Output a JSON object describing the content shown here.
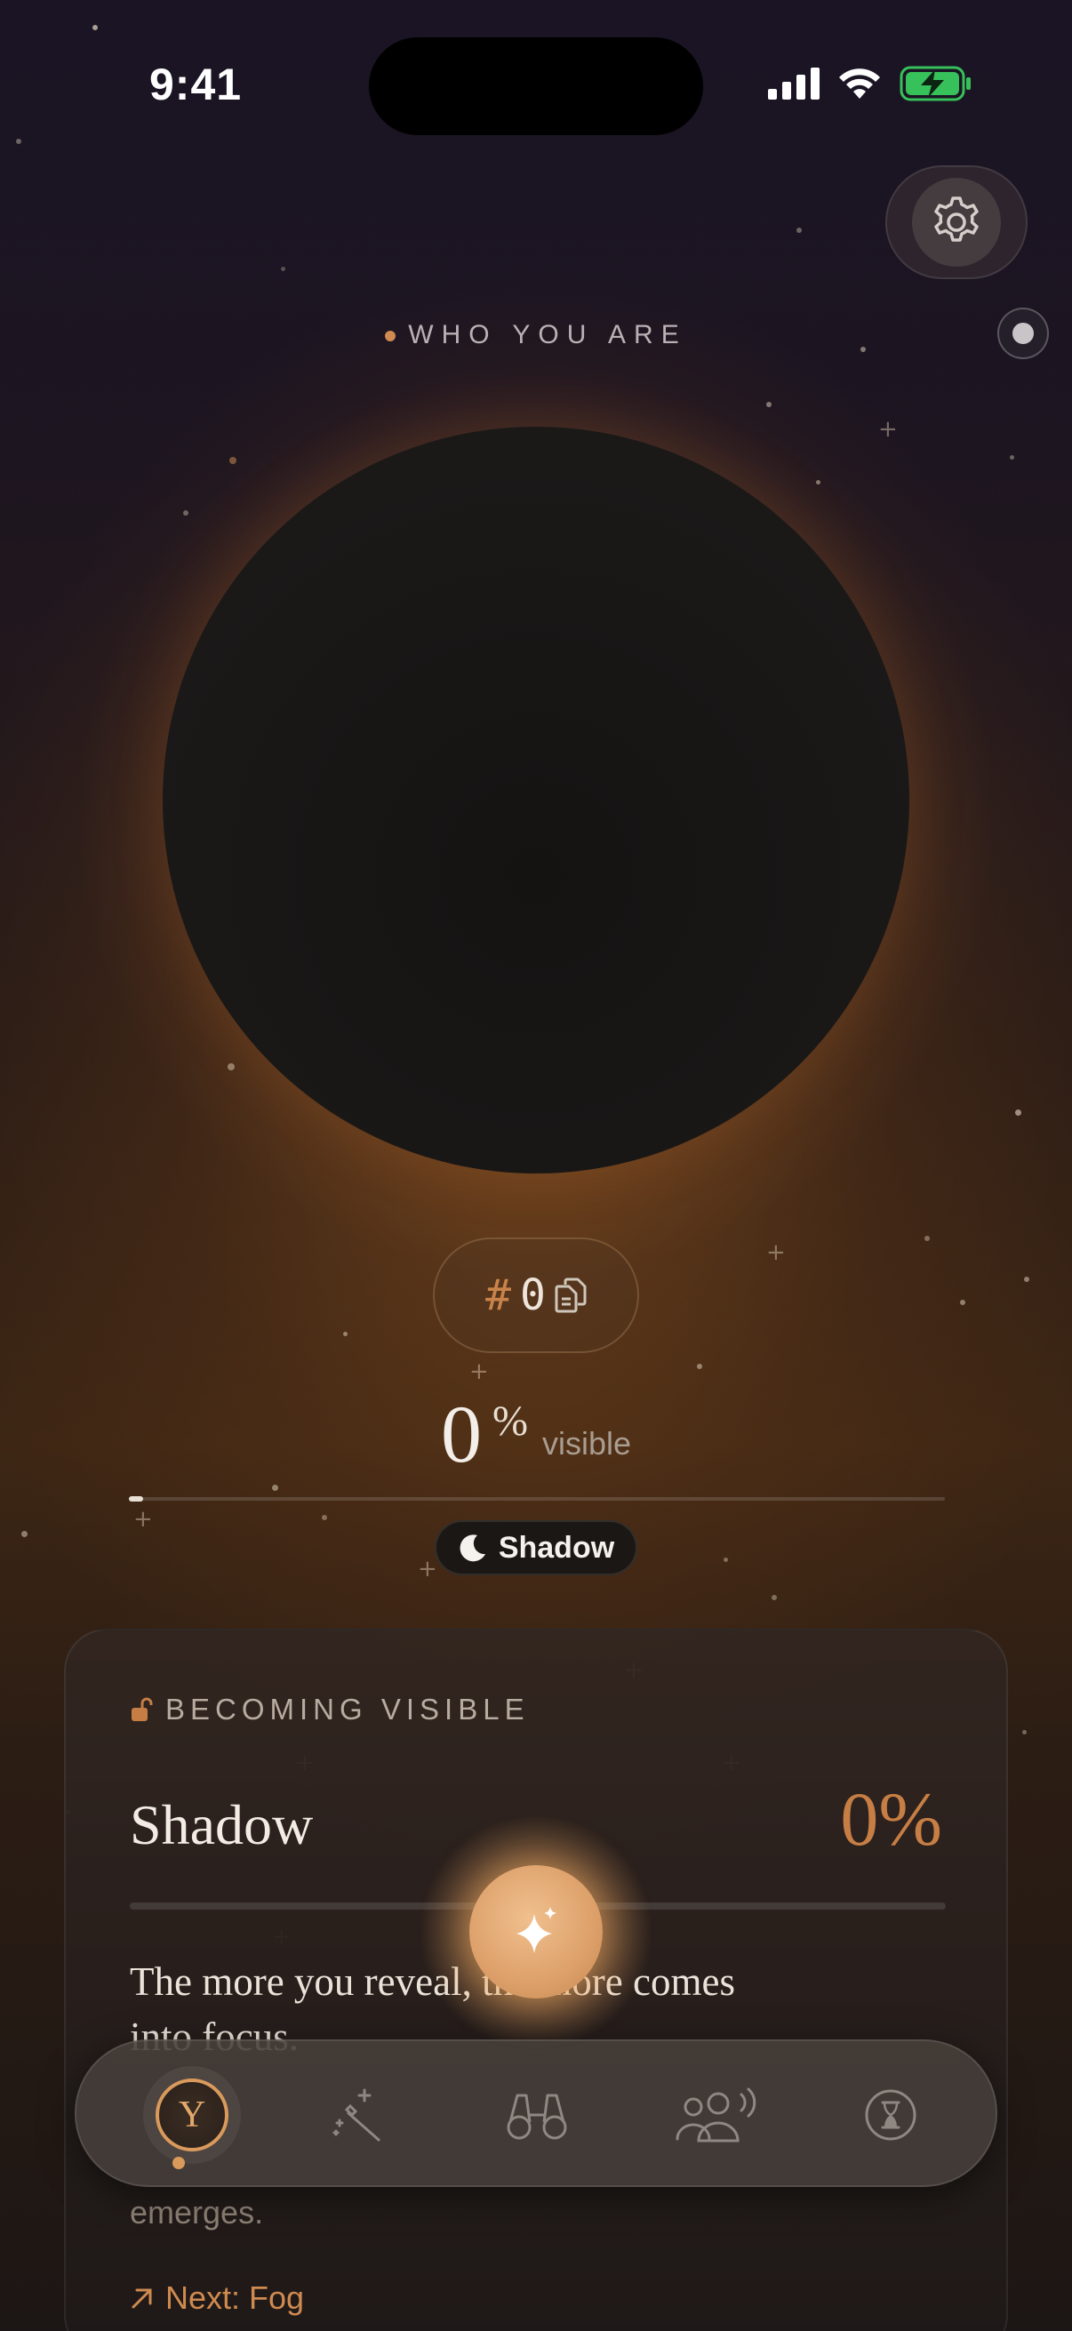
{
  "status_bar": {
    "time": "9:41",
    "icons": [
      "cellular-signal-icon",
      "wifi-icon",
      "battery-charging-icon"
    ],
    "battery_color": "#37c15a"
  },
  "header": {
    "settings_icon": "gear-icon",
    "label": "WHO YOU ARE"
  },
  "identity": {
    "id_prefix": "#",
    "id_value": "0",
    "copy_icon": "copy-icon"
  },
  "visibility": {
    "value": "0",
    "unit": "%",
    "word": "visible",
    "progress": 0.01
  },
  "phase": {
    "icon": "moon-icon",
    "label": "Shadow"
  },
  "card": {
    "eyebrow_icon": "unlocked-icon",
    "eyebrow": "BECOMING VISIBLE",
    "title": "Shadow",
    "percent": "0%",
    "progress": 0,
    "body_line_1": "The more you reveal, the more comes",
    "body_line_2": "into focus.",
    "body_2": "emerges.",
    "next_icon": "arrow-up-right-icon",
    "next_label": "Next: Fog"
  },
  "fab": {
    "icon": "sparkles-icon"
  },
  "tabbar": {
    "tabs": [
      {
        "id": "you",
        "letter": "Y",
        "active": true
      },
      {
        "id": "magic",
        "icon": "magic-wand-icon"
      },
      {
        "id": "explore",
        "icon": "binoculars-icon"
      },
      {
        "id": "people",
        "icon": "people-icon"
      },
      {
        "id": "time",
        "icon": "hourglass-icon"
      }
    ]
  },
  "colors": {
    "accent": "#c67e44",
    "accent_light": "#d99a5c"
  }
}
